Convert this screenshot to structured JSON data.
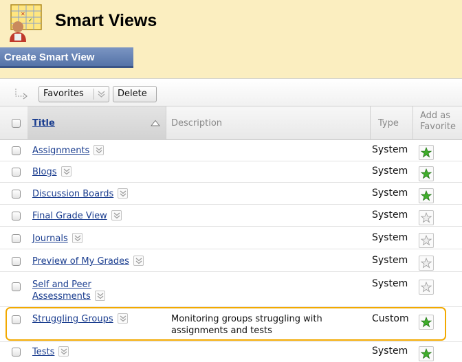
{
  "page": {
    "title": "Smart Views",
    "icon": "smart-views-gradebook-icon",
    "create_button_label": "Create Smart View"
  },
  "toolbar": {
    "favorites_label": "Favorites",
    "delete_label": "Delete",
    "icons": [
      "arrow-right-icon",
      "chevron-down-icon"
    ]
  },
  "table": {
    "columns": {
      "title": "Title",
      "description": "Description",
      "type": "Type",
      "favorite_line1": "Add as",
      "favorite_line2": "Favorite"
    },
    "sort": {
      "column": "Title",
      "direction": "ascending"
    },
    "rows": [
      {
        "title": "Assignments",
        "title_line2": "",
        "description_line1": "",
        "description_line2": "",
        "type": "System",
        "favorite": true
      },
      {
        "title": "Blogs",
        "title_line2": "",
        "description_line1": "",
        "description_line2": "",
        "type": "System",
        "favorite": true
      },
      {
        "title": "Discussion Boards",
        "title_line2": "",
        "description_line1": "",
        "description_line2": "",
        "type": "System",
        "favorite": true
      },
      {
        "title": "Final Grade View",
        "title_line2": "",
        "description_line1": "",
        "description_line2": "",
        "type": "System",
        "favorite": false
      },
      {
        "title": "Journals",
        "title_line2": "",
        "description_line1": "",
        "description_line2": "",
        "type": "System",
        "favorite": false
      },
      {
        "title": "Preview of My Grades",
        "title_line2": "",
        "description_line1": "",
        "description_line2": "",
        "type": "System",
        "favorite": false
      },
      {
        "title": "Self and Peer",
        "title_line2": "Assessments",
        "description_line1": "",
        "description_line2": "",
        "type": "System",
        "favorite": false
      },
      {
        "title": "Struggling Groups",
        "title_line2": "",
        "description_line1": "Monitoring groups struggling with",
        "description_line2": "assignments and tests",
        "type": "Custom",
        "favorite": true,
        "highlighted": true
      },
      {
        "title": "Tests",
        "title_line2": "",
        "description_line1": "",
        "description_line2": "",
        "type": "System",
        "favorite": true
      }
    ]
  },
  "colors": {
    "header_bg": "#fbeec0",
    "button_bg": "#5f7db2",
    "link": "#1a3d8f",
    "highlight": "#f2a900",
    "star_on": "#3fae2a",
    "star_off": "#e6e6e6"
  }
}
